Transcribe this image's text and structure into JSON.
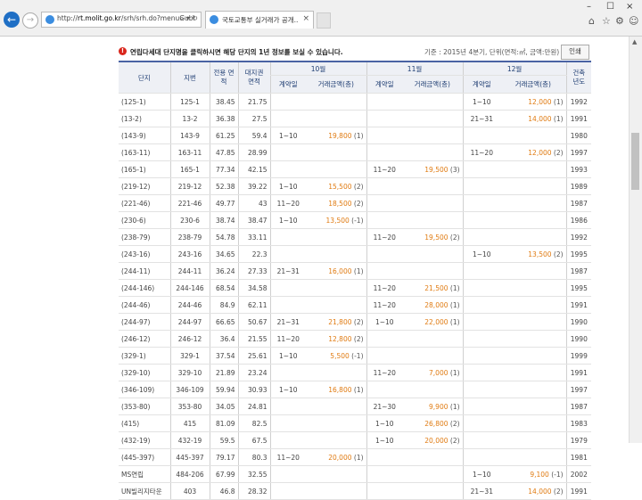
{
  "browser": {
    "url_host": "rt.molit.go.kr",
    "url_rest": "/srh/srh.do?menuGubr",
    "url_prefix": "http://",
    "search_icon": "search-icon",
    "tab_title": "국토교통부 실거래가 공개...",
    "close_glyph": "×",
    "min_glyph": "–",
    "max_glyph": "☐",
    "win_close_glyph": "×",
    "home_glyph": "⌂",
    "star_glyph": "☆",
    "gear_glyph": "⚙",
    "smile_glyph": "☺"
  },
  "header": {
    "alert_glyph": "!",
    "message": "연립다세대 단지명을 클릭하시면 해당 단지의 1년 정보를 보실 수 있습니다.",
    "basis": "기준 : 2015년 4분기, 단위(면적:㎡, 금액:만원)",
    "print_label": "인쇄"
  },
  "columns": {
    "complex": "단지",
    "lot": "지번",
    "exclusive_area": "전용 면적",
    "land_area": "대지권 면적",
    "month_10": "10월",
    "month_11": "11월",
    "month_12": "12월",
    "contract_day": "계약일",
    "price": "거래금액(층)",
    "built_year": "건축 년도"
  },
  "rows": [
    {
      "name": "(125-1)",
      "lot": "125-1",
      "area": "38.45",
      "land": "21.75",
      "m10": [
        "",
        "",
        ""
      ],
      "m11": [
        "",
        "",
        ""
      ],
      "m12": [
        "1~10",
        "12,000",
        "(1)"
      ],
      "year": "1992"
    },
    {
      "name": "(13-2)",
      "lot": "13-2",
      "area": "36.38",
      "land": "27.5",
      "m10": [
        "",
        "",
        ""
      ],
      "m11": [
        "",
        "",
        ""
      ],
      "m12": [
        "21~31",
        "14,000",
        "(1)"
      ],
      "year": "1991"
    },
    {
      "name": "(143-9)",
      "lot": "143-9",
      "area": "61.25",
      "land": "59.4",
      "m10": [
        "1~10",
        "19,800",
        "(1)"
      ],
      "m11": [
        "",
        "",
        ""
      ],
      "m12": [
        "",
        "",
        ""
      ],
      "year": "1980"
    },
    {
      "name": "(163-11)",
      "lot": "163-11",
      "area": "47.85",
      "land": "28.99",
      "m10": [
        "",
        "",
        ""
      ],
      "m11": [
        "",
        "",
        ""
      ],
      "m12": [
        "11~20",
        "12,000",
        "(2)"
      ],
      "year": "1997"
    },
    {
      "name": "(165-1)",
      "lot": "165-1",
      "area": "77.34",
      "land": "42.15",
      "m10": [
        "",
        "",
        ""
      ],
      "m11": [
        "11~20",
        "19,500",
        "(3)"
      ],
      "m12": [
        "",
        "",
        ""
      ],
      "year": "1993"
    },
    {
      "name": "(219-12)",
      "lot": "219-12",
      "area": "52.38",
      "land": "39.22",
      "m10": [
        "1~10",
        "15,500",
        "(2)"
      ],
      "m11": [
        "",
        "",
        ""
      ],
      "m12": [
        "",
        "",
        ""
      ],
      "year": "1989"
    },
    {
      "name": "(221-46)",
      "lot": "221-46",
      "area": "49.77",
      "land": "43",
      "m10": [
        "11~20",
        "18,500",
        "(2)"
      ],
      "m11": [
        "",
        "",
        ""
      ],
      "m12": [
        "",
        "",
        ""
      ],
      "year": "1987"
    },
    {
      "name": "(230-6)",
      "lot": "230-6",
      "area": "38.74",
      "land": "38.47",
      "m10": [
        "1~10",
        "13,500",
        "(-1)"
      ],
      "m11": [
        "",
        "",
        ""
      ],
      "m12": [
        "",
        "",
        ""
      ],
      "year": "1986"
    },
    {
      "name": "(238-79)",
      "lot": "238-79",
      "area": "54.78",
      "land": "33.11",
      "m10": [
        "",
        "",
        ""
      ],
      "m11": [
        "11~20",
        "19,500",
        "(2)"
      ],
      "m12": [
        "",
        "",
        ""
      ],
      "year": "1992"
    },
    {
      "name": "(243-16)",
      "lot": "243-16",
      "area": "34.65",
      "land": "22.3",
      "m10": [
        "",
        "",
        ""
      ],
      "m11": [
        "",
        "",
        ""
      ],
      "m12": [
        "1~10",
        "13,500",
        "(2)"
      ],
      "year": "1995"
    },
    {
      "name": "(244-11)",
      "lot": "244-11",
      "area": "36.24",
      "land": "27.33",
      "m10": [
        "21~31",
        "16,000",
        "(1)"
      ],
      "m11": [
        "",
        "",
        ""
      ],
      "m12": [
        "",
        "",
        ""
      ],
      "year": "1987"
    },
    {
      "name": "(244-146)",
      "lot": "244-146",
      "area": "68.54",
      "land": "34.58",
      "m10": [
        "",
        "",
        ""
      ],
      "m11": [
        "11~20",
        "21,500",
        "(1)"
      ],
      "m12": [
        "",
        "",
        ""
      ],
      "year": "1995"
    },
    {
      "name": "(244-46)",
      "lot": "244-46",
      "area": "84.9",
      "land": "62.11",
      "m10": [
        "",
        "",
        ""
      ],
      "m11": [
        "11~20",
        "28,000",
        "(1)"
      ],
      "m12": [
        "",
        "",
        ""
      ],
      "year": "1991"
    },
    {
      "name": "(244-97)",
      "lot": "244-97",
      "area": "66.65",
      "land": "50.67",
      "m10": [
        "21~31",
        "21,800",
        "(2)"
      ],
      "m11": [
        "1~10",
        "22,000",
        "(1)"
      ],
      "m12": [
        "",
        "",
        ""
      ],
      "year": "1990"
    },
    {
      "name": "(246-12)",
      "lot": "246-12",
      "area": "36.4",
      "land": "21.55",
      "m10": [
        "11~20",
        "12,800",
        "(2)"
      ],
      "m11": [
        "",
        "",
        ""
      ],
      "m12": [
        "",
        "",
        ""
      ],
      "year": "1990"
    },
    {
      "name": "(329-1)",
      "lot": "329-1",
      "area": "37.54",
      "land": "25.61",
      "m10": [
        "1~10",
        "5,500",
        "(-1)"
      ],
      "m11": [
        "",
        "",
        ""
      ],
      "m12": [
        "",
        "",
        ""
      ],
      "year": "1999"
    },
    {
      "name": "(329-10)",
      "lot": "329-10",
      "area": "21.89",
      "land": "23.24",
      "m10": [
        "",
        "",
        ""
      ],
      "m11": [
        "11~20",
        "7,000",
        "(1)"
      ],
      "m12": [
        "",
        "",
        ""
      ],
      "year": "1991"
    },
    {
      "name": "(346-109)",
      "lot": "346-109",
      "area": "59.94",
      "land": "30.93",
      "m10": [
        "1~10",
        "16,800",
        "(1)"
      ],
      "m11": [
        "",
        "",
        ""
      ],
      "m12": [
        "",
        "",
        ""
      ],
      "year": "1997"
    },
    {
      "name": "(353-80)",
      "lot": "353-80",
      "area": "34.05",
      "land": "24.81",
      "m10": [
        "",
        "",
        ""
      ],
      "m11": [
        "21~30",
        "9,900",
        "(1)"
      ],
      "m12": [
        "",
        "",
        ""
      ],
      "year": "1987"
    },
    {
      "name": "(415)",
      "lot": "415",
      "area": "81.09",
      "land": "82.5",
      "m10": [
        "",
        "",
        ""
      ],
      "m11": [
        "1~10",
        "26,800",
        "(2)"
      ],
      "m12": [
        "",
        "",
        ""
      ],
      "year": "1983"
    },
    {
      "name": "(432-19)",
      "lot": "432-19",
      "area": "59.5",
      "land": "67.5",
      "m10": [
        "",
        "",
        ""
      ],
      "m11": [
        "1~10",
        "20,000",
        "(2)"
      ],
      "m12": [
        "",
        "",
        ""
      ],
      "year": "1979"
    },
    {
      "name": "(445-397)",
      "lot": "445-397",
      "area": "79.17",
      "land": "80.3",
      "m10": [
        "11~20",
        "20,000",
        "(1)"
      ],
      "m11": [
        "",
        "",
        ""
      ],
      "m12": [
        "",
        "",
        ""
      ],
      "year": "1981"
    },
    {
      "name": "MS연립",
      "lot": "484-206",
      "area": "67.99",
      "land": "32.55",
      "m10": [
        "",
        "",
        ""
      ],
      "m11": [
        "",
        "",
        ""
      ],
      "m12": [
        "1~10",
        "9,100",
        "(-1)"
      ],
      "year": "2002"
    },
    {
      "name": "UN빌리지타운",
      "lot": "403",
      "area": "46.8",
      "land": "28.32",
      "m10": [
        "",
        "",
        ""
      ],
      "m11": [
        "",
        "",
        ""
      ],
      "m12": [
        "21~31",
        "14,000",
        "(2)"
      ],
      "year": "1991"
    }
  ]
}
